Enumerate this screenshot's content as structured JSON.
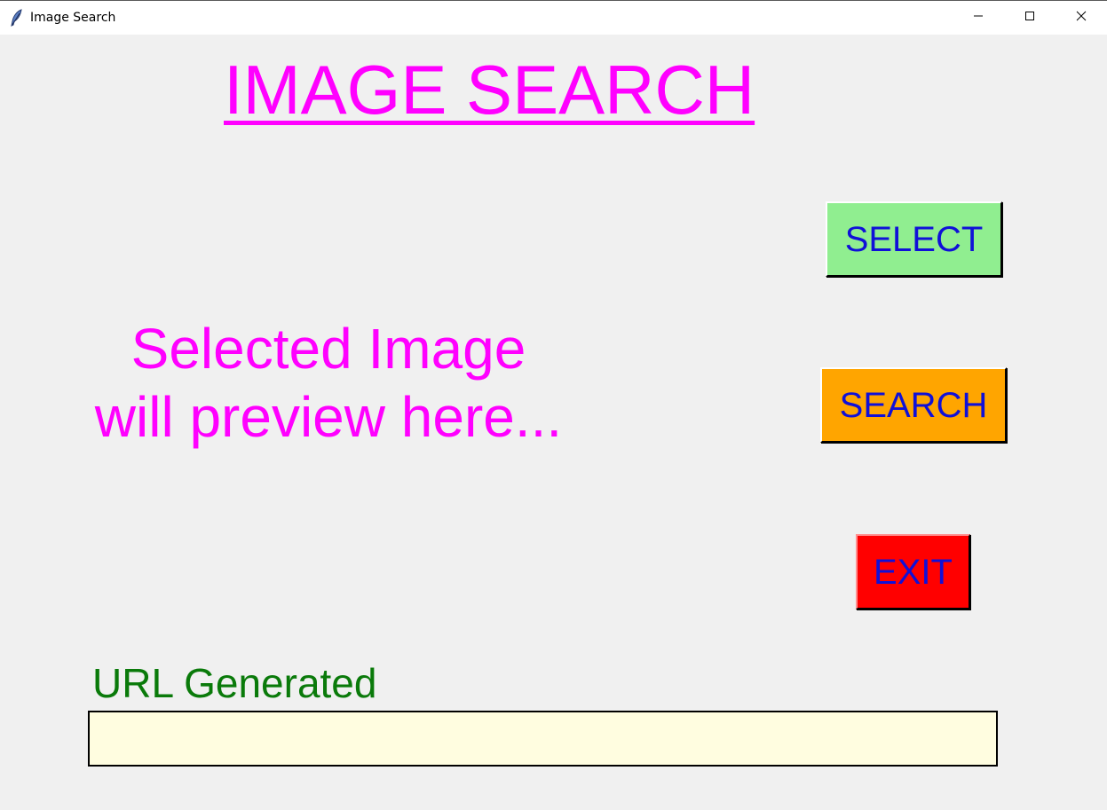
{
  "window": {
    "title": "Image Search",
    "app_icon": "feather-icon",
    "controls": {
      "minimize_icon": "minimize-icon",
      "maximize_icon": "maximize-icon",
      "close_icon": "close-icon"
    }
  },
  "main": {
    "heading": "IMAGE SEARCH",
    "preview_line1": "Selected Image",
    "preview_line2": "will preview here...",
    "buttons": {
      "select_label": "SELECT",
      "search_label": "SEARCH",
      "exit_label": "EXIT"
    },
    "url_label": "URL Generated",
    "url_value": ""
  },
  "colors": {
    "background": "#f0f0f0",
    "heading": "#ff00ff",
    "preview_text": "#ff00ff",
    "button_text": "#1010d8",
    "select_bg": "#90ee90",
    "search_bg": "#ffa500",
    "exit_bg": "#ff0000",
    "url_label": "#0a7a0a",
    "url_field_bg": "#fffde0"
  }
}
